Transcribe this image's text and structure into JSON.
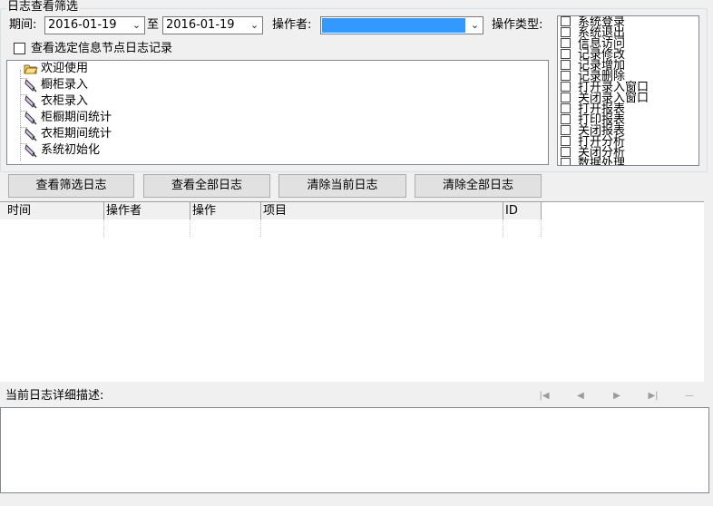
{
  "filter": {
    "group_title": "日志查看筛选",
    "period_label": "期间:",
    "date_from": "2016-01-19",
    "to_label": "至",
    "date_to": "2016-01-19",
    "operator_label": "操作者:",
    "operator_value": "",
    "op_type_label": "操作类型:",
    "node_checkbox_label": "查看选定信息节点日志记录",
    "node_checkbox_checked": false
  },
  "tree": {
    "items": [
      {
        "label": "欢迎使用",
        "icon": "folder-icon"
      },
      {
        "label": "橱柜录入",
        "icon": "module-icon"
      },
      {
        "label": "衣柜录入",
        "icon": "module-icon"
      },
      {
        "label": "柜橱期间统计",
        "icon": "module-icon"
      },
      {
        "label": "衣柜期间统计",
        "icon": "module-icon"
      },
      {
        "label": "系统初始化",
        "icon": "module-icon"
      }
    ]
  },
  "op_types": [
    "系统登录",
    "系统退出",
    "信息访问",
    "记录修改",
    "记录增加",
    "记录删除",
    "打开录入窗口",
    "关闭录入窗口",
    "打开报表",
    "打印报表",
    "关闭报表",
    "打开分析",
    "关闭分析",
    "数据处理"
  ],
  "buttons": {
    "view_filtered": "查看筛选日志",
    "view_all": "查看全部日志",
    "clear_current": "清除当前日志",
    "clear_all": "清除全部日志"
  },
  "grid": {
    "columns": [
      "时间",
      "操作者",
      "操作",
      "项目",
      "ID"
    ],
    "rows": []
  },
  "detail": {
    "label": "当前日志详细描述:",
    "value": ""
  },
  "nav_icons": [
    "first-record-icon",
    "prev-record-icon",
    "next-record-icon",
    "last-record-icon",
    "new-record-icon"
  ],
  "colors": {
    "selection": "#3399ff",
    "window_bg": "#f0f0f0",
    "button_bg": "#e1e1e1"
  }
}
